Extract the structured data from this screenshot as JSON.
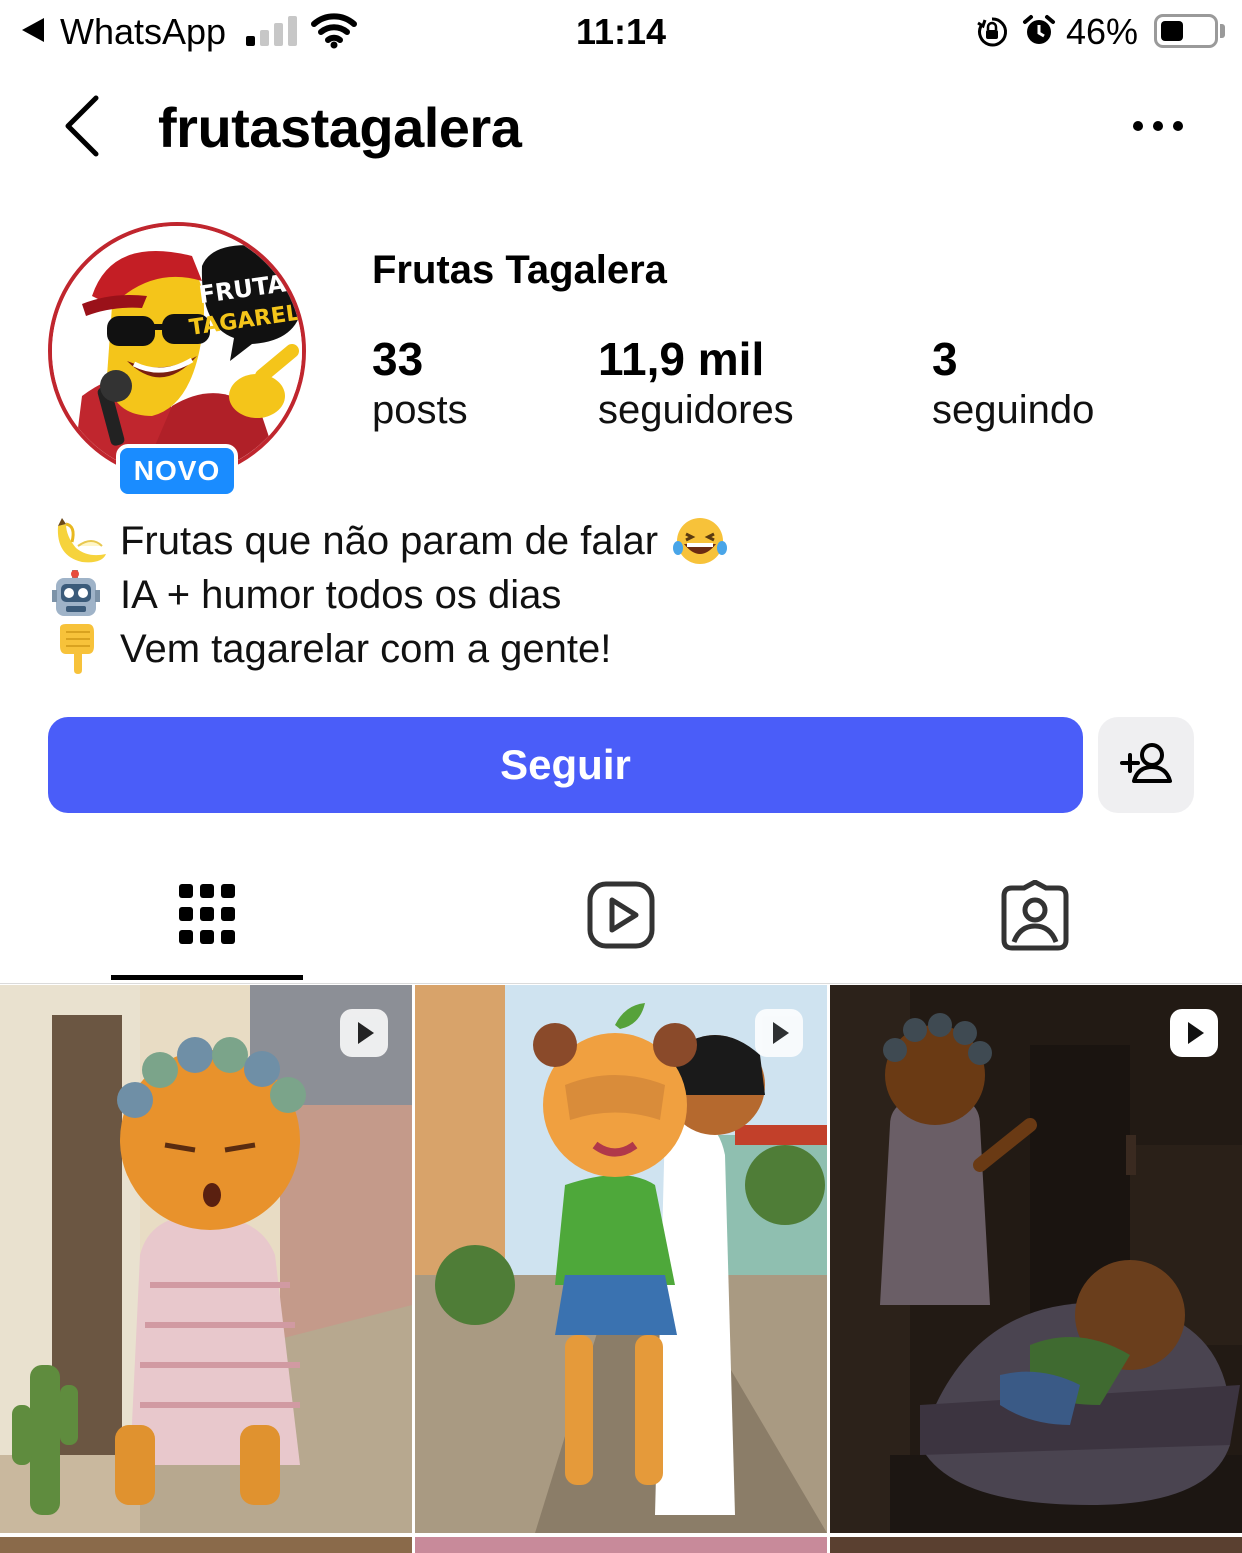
{
  "status_bar": {
    "app_name": "WhatsApp",
    "time": "11:14",
    "battery_percent": "46%",
    "battery_level": 0.46,
    "signal_bars": 1
  },
  "header": {
    "username": "frutastagalera"
  },
  "profile": {
    "avatar_badge": "NOVO",
    "avatar_logo_text": [
      "FRUTAS",
      "TAGARELA"
    ],
    "display_name": "Frutas Tagalera",
    "stats": [
      {
        "value": "33",
        "label": "posts"
      },
      {
        "value": "11,9 mil",
        "label": "seguidores"
      },
      {
        "value": "3",
        "label": "seguindo"
      }
    ],
    "bio": [
      {
        "icon": "banana-emoji",
        "text": "Frutas que não param de falar",
        "end_icon": "laughing-emoji"
      },
      {
        "icon": "robot-emoji",
        "text": "IA + humor todos os dias"
      },
      {
        "icon": "pointing-down-emoji",
        "text": "Vem tagarelar com a gente!"
      }
    ]
  },
  "actions": {
    "follow_label": "Seguir"
  },
  "tabs": [
    {
      "icon": "grid-icon",
      "selected": true
    },
    {
      "icon": "reels-icon",
      "selected": false
    },
    {
      "icon": "tagged-icon",
      "selected": false
    }
  ],
  "colors": {
    "follow_button": "#4a5df9",
    "novo_badge": "#1a8cff",
    "avatar_ring": "#c0262e"
  }
}
